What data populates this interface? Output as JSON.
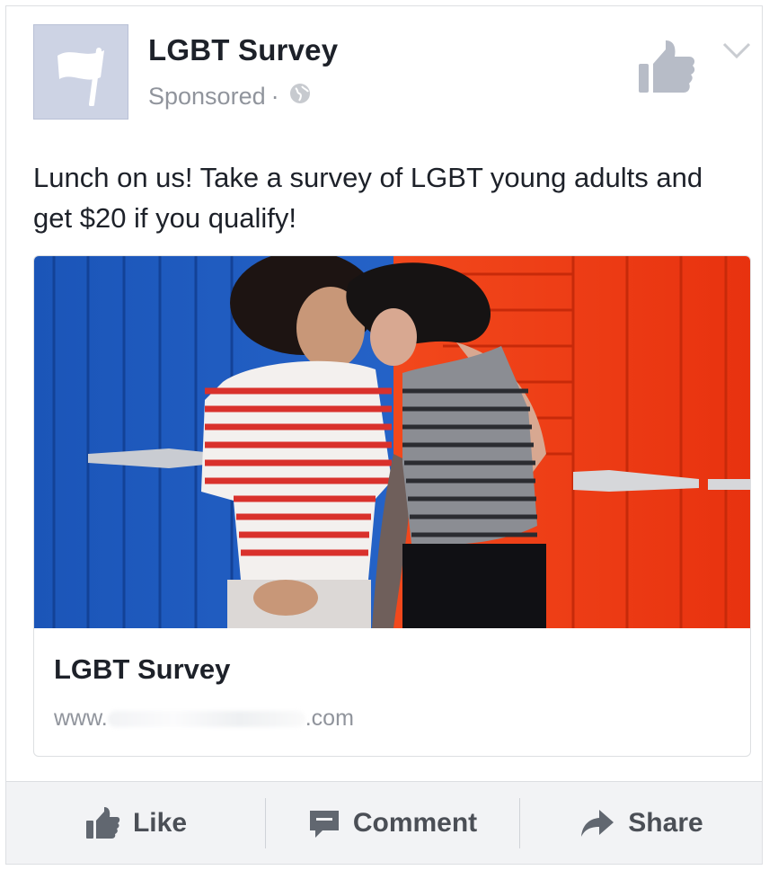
{
  "post": {
    "page_name": "LGBT Survey",
    "sponsored_label": "Sponsored",
    "separator": "·",
    "privacy_icon": "globe-icon",
    "text": "Lunch on us! Take a survey of LGBT young adults and get $20 if you qualify!"
  },
  "link_preview": {
    "title": "LGBT Survey",
    "url_prefix": "www.",
    "url_suffix": ".com"
  },
  "actions": {
    "like": "Like",
    "comment": "Comment",
    "share": "Share"
  },
  "colors": {
    "action_text": "#4b4f56",
    "muted_text": "#90949c",
    "avatar_bg": "#cdd3e4"
  }
}
